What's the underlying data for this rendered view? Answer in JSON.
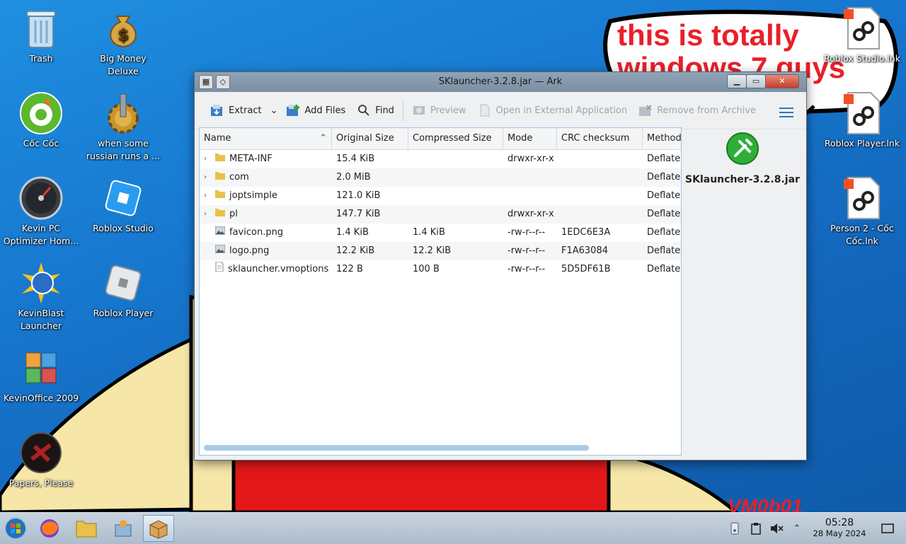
{
  "wallpaper": {
    "line1": "this is totally",
    "line2": "windows 7 guys",
    "signature": "VM0b01"
  },
  "desktop_left": [
    {
      "label": "Trash",
      "icon": "trash-icon"
    },
    {
      "label": "Big Money Deluxe",
      "icon": "money-bag-icon"
    },
    {
      "label": "Cốc Cốc",
      "icon": "coccoc-icon"
    },
    {
      "label": "when some russian runs a ...",
      "icon": "gear-icon"
    },
    {
      "label": "Kevin PC Optimizer Hom...",
      "icon": "gauge-icon"
    },
    {
      "label": "Roblox Studio",
      "icon": "roblox-studio-icon"
    },
    {
      "label": "KevinBlast Launcher",
      "icon": "globe-burst-icon"
    },
    {
      "label": "Roblox Player",
      "icon": "roblox-player-icon"
    },
    {
      "label": "KevinOffice 2009",
      "icon": "office-icon"
    },
    {
      "label": "Papers, Please",
      "icon": "papers-please-icon"
    }
  ],
  "desktop_right": [
    {
      "label": "Roblox Studio.lnk",
      "icon": "shortcut-icon"
    },
    {
      "label": "Roblox Player.lnk",
      "icon": "shortcut-icon"
    },
    {
      "label": "Person 2 - Cốc Cốc.lnk",
      "icon": "shortcut-icon"
    }
  ],
  "window": {
    "title": "SKlauncher-3.2.8.jar — Ark",
    "controls": {
      "minimize": "▁",
      "maximize": "▭",
      "close": "✕"
    },
    "toolbar": {
      "extract": "Extract",
      "add_files": "Add Files",
      "find": "Find",
      "preview": "Preview",
      "open_external": "Open in External Application",
      "remove": "Remove from Archive"
    },
    "columns": [
      "Name",
      "Original Size",
      "Compressed Size",
      "Mode",
      "CRC checksum",
      "Method"
    ],
    "rows": [
      {
        "name": "META-INF",
        "orig": "15.4 KiB",
        "comp": "",
        "mode": "drwxr-xr-x",
        "crc": "",
        "method": "Deflate",
        "type": "folder"
      },
      {
        "name": "com",
        "orig": "2.0 MiB",
        "comp": "",
        "mode": "",
        "crc": "",
        "method": "Deflate",
        "type": "folder"
      },
      {
        "name": "joptsimple",
        "orig": "121.0 KiB",
        "comp": "",
        "mode": "",
        "crc": "",
        "method": "Deflate",
        "type": "folder"
      },
      {
        "name": "pl",
        "orig": "147.7 KiB",
        "comp": "",
        "mode": "drwxr-xr-x",
        "crc": "",
        "method": "Deflate",
        "type": "folder"
      },
      {
        "name": "favicon.png",
        "orig": "1.4 KiB",
        "comp": "1.4 KiB",
        "mode": "-rw-r--r--",
        "crc": "1EDC6E3A",
        "method": "Deflate",
        "type": "image"
      },
      {
        "name": "logo.png",
        "orig": "12.2 KiB",
        "comp": "12.2 KiB",
        "mode": "-rw-r--r--",
        "crc": "F1A63084",
        "method": "Deflate",
        "type": "image"
      },
      {
        "name": "sklauncher.vmoptions",
        "orig": "122 B",
        "comp": "100 B",
        "mode": "-rw-r--r--",
        "crc": "5D5DF61B",
        "method": "Deflate",
        "type": "text"
      }
    ],
    "side_panel": {
      "filename": "SKlauncher-3.2.8.jar"
    }
  },
  "taskbar": {
    "time": "05:28",
    "date": "28 May 2024"
  },
  "colors": {
    "accent": "#2a78c2",
    "wallpaper_text": "#e8202a"
  }
}
